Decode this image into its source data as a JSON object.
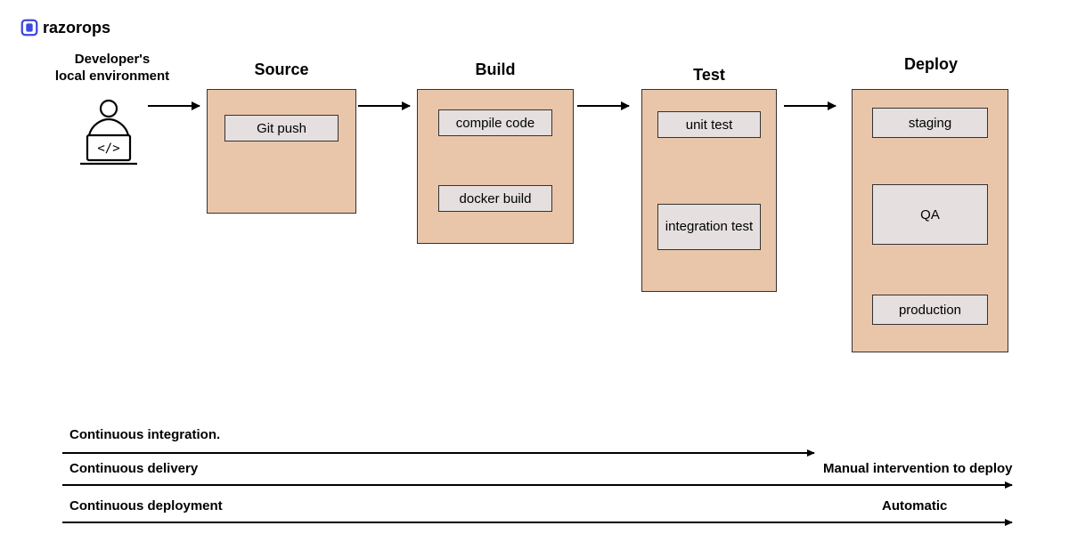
{
  "logo": {
    "text": "razorops"
  },
  "developer": {
    "label_line1": "Developer's",
    "label_line2": "local environment"
  },
  "stages": {
    "source": {
      "title": "Source",
      "chips": [
        "Git push"
      ]
    },
    "build": {
      "title": "Build",
      "chips": [
        "compile code",
        "docker build"
      ]
    },
    "test": {
      "title": "Test",
      "chips": [
        "unit test",
        "integration test"
      ]
    },
    "deploy": {
      "title": "Deploy",
      "chips": [
        "staging",
        "QA",
        "production"
      ]
    }
  },
  "flows": {
    "ci": {
      "label": "Continuous integration.",
      "right": ""
    },
    "cd": {
      "label": "Continuous delivery",
      "right": "Manual intervention to deploy"
    },
    "cdeploy": {
      "label": "Continuous deployment",
      "right": "Automatic"
    }
  }
}
